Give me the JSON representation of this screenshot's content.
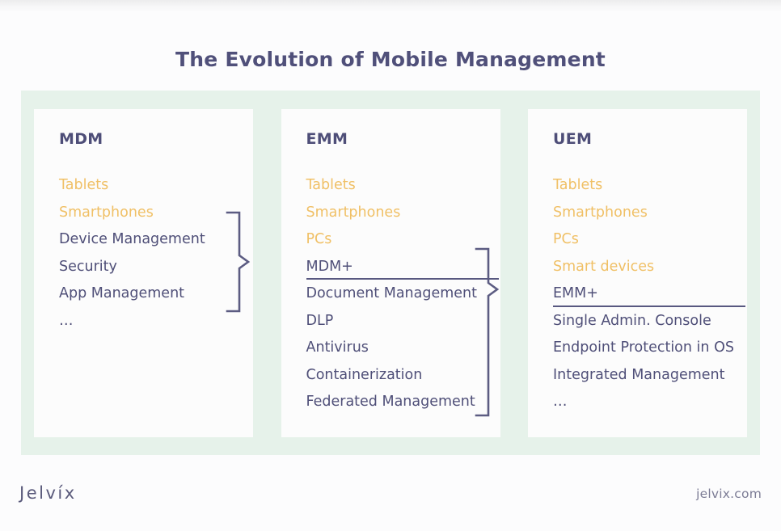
{
  "title": "The Evolution of Mobile Management",
  "colors": {
    "page_background": "#fcfcfd",
    "panel_mint": "#e6f2ea",
    "card_background": "#fcfcfc",
    "heading_purple": "#4e4e78",
    "body_purple": "#4f4f78",
    "device_amber": "#f0c066",
    "rule": "#585880",
    "footer_gray": "#7c7c95"
  },
  "columns": [
    {
      "id": "mdm",
      "title": "MDM",
      "items": [
        {
          "label": "Tablets",
          "kind": "device"
        },
        {
          "label": "Smartphones",
          "kind": "device"
        },
        {
          "label": "Device Management",
          "kind": "feature"
        },
        {
          "label": "Security",
          "kind": "feature"
        },
        {
          "label": "App Management",
          "kind": "feature"
        },
        {
          "label": "…",
          "kind": "ellipsis"
        }
      ]
    },
    {
      "id": "emm",
      "title": "EMM",
      "items": [
        {
          "label": "Tablets",
          "kind": "device"
        },
        {
          "label": "Smartphones",
          "kind": "device"
        },
        {
          "label": "PCs",
          "kind": "device"
        },
        {
          "label": "MDM+",
          "kind": "plus"
        },
        {
          "label": "Document Management",
          "kind": "feature"
        },
        {
          "label": "DLP",
          "kind": "feature"
        },
        {
          "label": "Antivirus",
          "kind": "feature"
        },
        {
          "label": "Containerization",
          "kind": "feature"
        },
        {
          "label": "Federated Management",
          "kind": "feature"
        }
      ]
    },
    {
      "id": "uem",
      "title": "UEM",
      "items": [
        {
          "label": "Tablets",
          "kind": "device"
        },
        {
          "label": "Smartphones",
          "kind": "device"
        },
        {
          "label": "PCs",
          "kind": "device"
        },
        {
          "label": "Smart devices",
          "kind": "device"
        },
        {
          "label": "EMM+",
          "kind": "plus"
        },
        {
          "label": "Single Admin. Console",
          "kind": "feature"
        },
        {
          "label": "Endpoint Protection in OS",
          "kind": "feature"
        },
        {
          "label": "Integrated Management",
          "kind": "feature"
        },
        {
          "label": "…",
          "kind": "ellipsis"
        }
      ]
    }
  ],
  "connectors": [
    {
      "id": "mdm-to-emm",
      "from": "mdm",
      "to": "emm",
      "shape": "right-pointing-brace"
    },
    {
      "id": "emm-to-uem",
      "from": "emm",
      "to": "uem",
      "shape": "right-pointing-brace"
    }
  ],
  "footer": {
    "logo": "Jelvíx",
    "site": "jelvix.com"
  }
}
